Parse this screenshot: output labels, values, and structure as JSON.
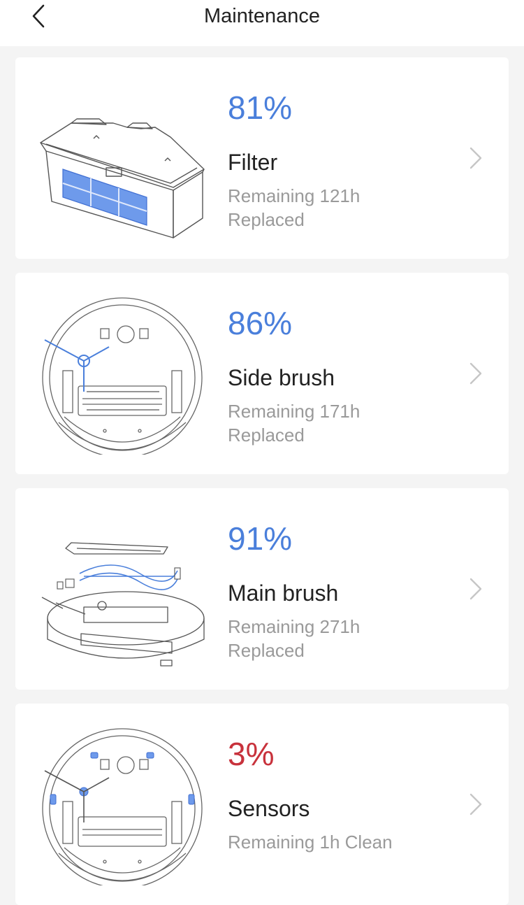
{
  "header": {
    "title": "Maintenance"
  },
  "accent_color": "#4a7fdb",
  "alert_color": "#c8323c",
  "items": [
    {
      "percent": "81%",
      "name": "Filter",
      "remaining": "Remaining 121h",
      "status": "Replaced",
      "icon": "filter-icon"
    },
    {
      "percent": "86%",
      "name": "Side brush",
      "remaining": "Remaining 171h",
      "status": "Replaced",
      "icon": "side-brush-icon"
    },
    {
      "percent": "91%",
      "name": "Main brush",
      "remaining": "Remaining 271h",
      "status": "Replaced",
      "icon": "main-brush-icon"
    },
    {
      "percent": "3%",
      "name": "Sensors",
      "remaining": "Remaining 1h Clean",
      "status": "",
      "icon": "sensors-icon"
    }
  ]
}
